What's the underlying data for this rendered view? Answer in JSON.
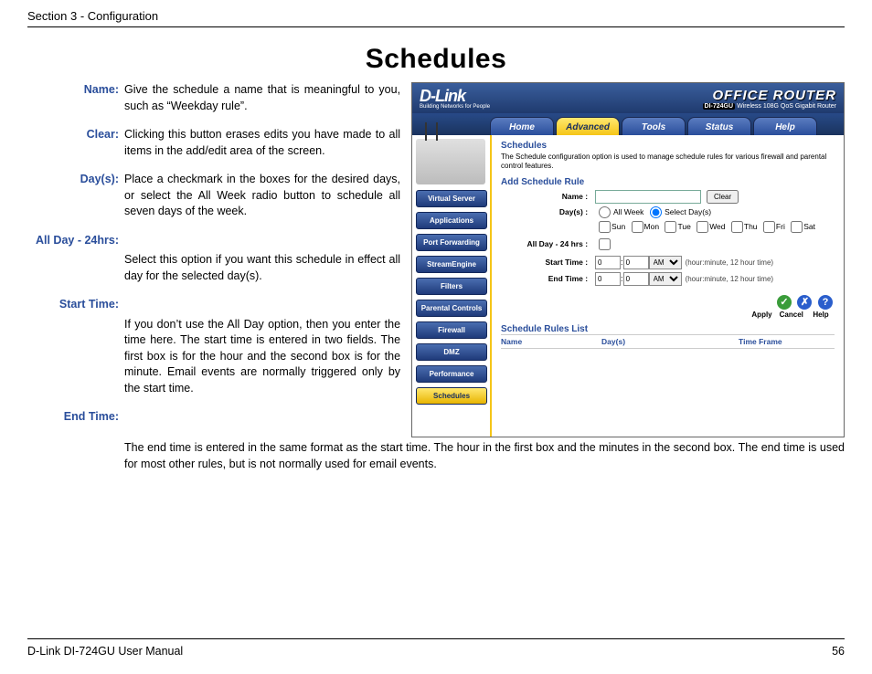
{
  "section_header": "Section 3 - Configuration",
  "page_title": "Schedules",
  "definitions": {
    "name": {
      "label": "Name:",
      "body": "Give the schedule a name that is meaningful to you, such as “Weekday rule”."
    },
    "clear": {
      "label": "Clear:",
      "body": "Clicking this button erases edits you have made to all items in the add/edit area of the screen."
    },
    "days": {
      "label": "Day(s):",
      "body": "Place a checkmark in the boxes for the desired days, or select the All Week radio button to schedule all seven days of the week."
    },
    "allday": {
      "label": "All Day - 24hrs:",
      "body": "Select this option if you want this schedule in effect all day for the selected day(s)."
    },
    "start": {
      "label": "Start Time:",
      "body": "If you don’t use the All Day option, then you enter the time here. The start time is entered in two fields. The first box is for the hour and the second box is for the minute. Email events are normally triggered only by the start time."
    },
    "end": {
      "label": "End Time:",
      "body": "The end time is entered in the same format as the start time. The hour in the first box and the minutes in the second box. The end time is used for most other rules, but is not normally used for email events."
    }
  },
  "router": {
    "brand": "D-Link",
    "brand_sub": "Building Networks for People",
    "product": "OFFICE ROUTER",
    "model": "DI-724GU",
    "model_desc": "Wireless 108G QoS Gigabit Router",
    "tabs": [
      "Home",
      "Advanced",
      "Tools",
      "Status",
      "Help"
    ],
    "active_tab": "Advanced",
    "side_items": [
      "Virtual Server",
      "Applications",
      "Port Forwarding",
      "StreamEngine",
      "Filters",
      "Parental Controls",
      "Firewall",
      "DMZ",
      "Performance",
      "Schedules"
    ],
    "active_side": "Schedules",
    "panel": {
      "title": "Schedules",
      "desc": "The Schedule configuration option is used to manage schedule rules for various firewall and parental control features.",
      "add_rule": "Add Schedule Rule",
      "labels": {
        "name": "Name :",
        "days": "Day(s) :",
        "allweek": "All Week",
        "seldays": "Select Day(s)",
        "day_names": [
          "Sun",
          "Mon",
          "Tue",
          "Wed",
          "Thu",
          "Fri",
          "Sat"
        ],
        "allday": "All Day - 24 hrs :",
        "start": "Start Time :",
        "end": "End Time :",
        "clear_btn": "Clear",
        "hint": "(hour:minute, 12 hour time)",
        "ampm": "AM"
      },
      "values": {
        "name": "",
        "start_h": "0",
        "start_m": "0",
        "end_h": "0",
        "end_m": "0"
      },
      "actions": {
        "apply": "Apply",
        "cancel": "Cancel",
        "help": "Help"
      },
      "rules_list_title": "Schedule Rules List",
      "rules_cols": [
        "Name",
        "Day(s)",
        "Time Frame"
      ]
    }
  },
  "footer": {
    "left": "D-Link DI-724GU User Manual",
    "right": "56"
  }
}
